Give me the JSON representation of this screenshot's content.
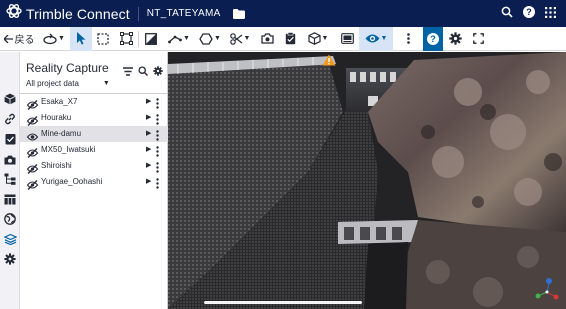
{
  "app": {
    "name": "Trimble Connect",
    "project": "NT_TATEYAMA"
  },
  "toolbar": {
    "back_label": "戻る"
  },
  "panel": {
    "title": "Reality Capture",
    "filter": "All project data",
    "items": [
      {
        "label": "Esaka_X7",
        "visible": false,
        "selected": false
      },
      {
        "label": "Houraku",
        "visible": false,
        "selected": false
      },
      {
        "label": "Mine-damu",
        "visible": true,
        "selected": true
      },
      {
        "label": "MX50_Iwatsuki",
        "visible": false,
        "selected": false
      },
      {
        "label": "Shiroishi",
        "visible": false,
        "selected": false
      },
      {
        "label": "Yurigae_Oohashi",
        "visible": false,
        "selected": false
      }
    ]
  },
  "icons": {
    "top_bar": [
      "trimble-logo-icon",
      "folder-icon",
      "search-icon",
      "help-icon",
      "apps-grid-icon"
    ],
    "toolbar": [
      "orbit-icon",
      "select-pointer-icon",
      "box-select-icon",
      "fit-frame-icon",
      "section-plane-icon",
      "measure-icon",
      "markup-shape-icon",
      "clip-icon",
      "camera-icon",
      "clipboard-icon",
      "cube-icon",
      "gallery-icon",
      "visibility-eye-icon",
      "more-vertical-icon",
      "help-icon",
      "settings-gear-icon",
      "fullscreen-icon"
    ],
    "sidebar": [
      "cube-icon",
      "link-icon",
      "checklist-icon",
      "camera-icon",
      "hierarchy-icon",
      "table-icon",
      "globe-icon",
      "reality-capture-icon",
      "settings-gear-icon"
    ]
  },
  "colors": {
    "header_bg": "#0a1e52",
    "accent_blue": "#0063a3",
    "active_tool_bg": "#d6e4f5",
    "selected_row_bg": "#e2e2e6",
    "warning": "#f29a1f"
  }
}
